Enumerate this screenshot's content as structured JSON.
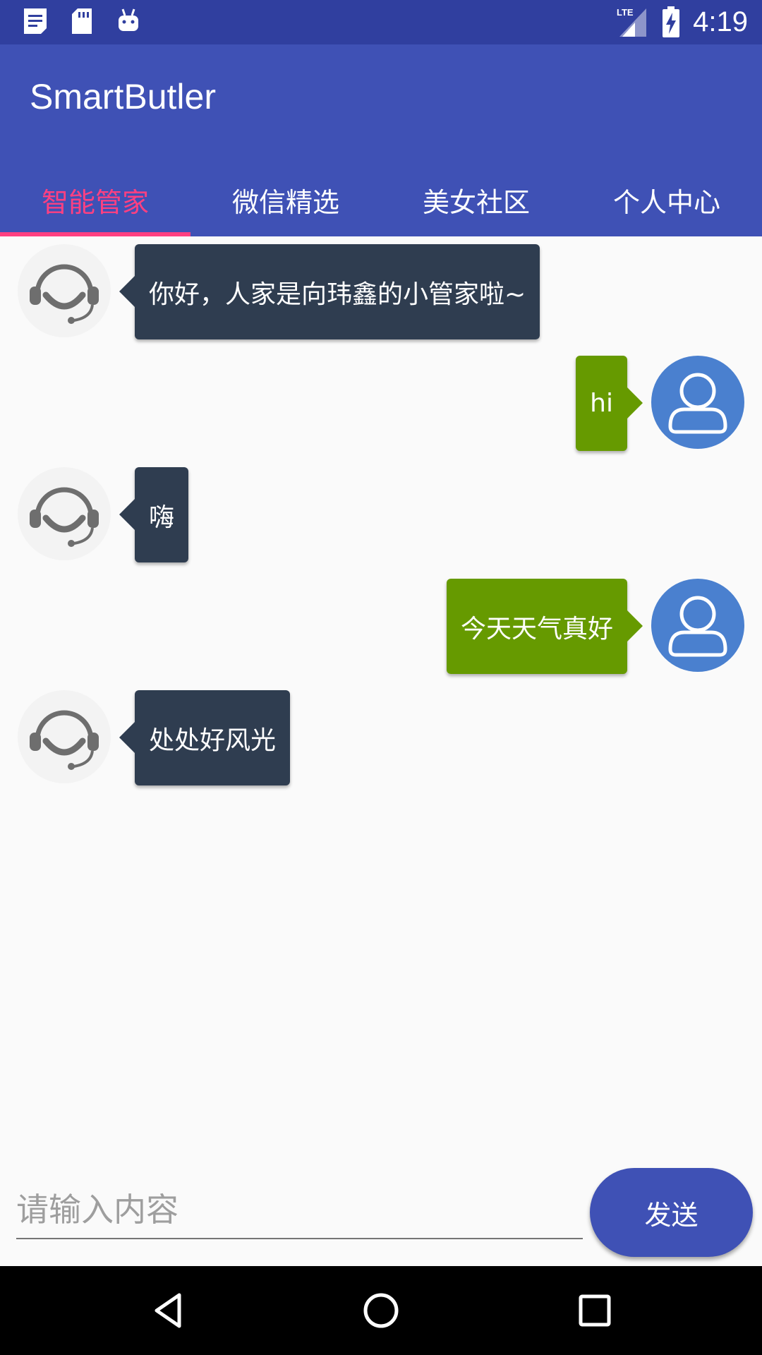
{
  "status_bar": {
    "time": "4:19",
    "network": "LTE",
    "left_icons": [
      "notes-icon",
      "sd-card-icon",
      "android-icon"
    ],
    "right_icons": [
      "lte-signal-icon",
      "battery-charging-icon"
    ]
  },
  "app": {
    "title": "SmartButler"
  },
  "tabs": [
    {
      "label": "智能管家",
      "active": true
    },
    {
      "label": "微信精选",
      "active": false
    },
    {
      "label": "美女社区",
      "active": false
    },
    {
      "label": "个人中心",
      "active": false
    }
  ],
  "messages": [
    {
      "sender": "bot",
      "text": "你好，人家是向玮鑫的小管家啦~"
    },
    {
      "sender": "user",
      "text": "hi"
    },
    {
      "sender": "bot",
      "text": "嗨"
    },
    {
      "sender": "user",
      "text": "今天天气真好"
    },
    {
      "sender": "bot",
      "text": "处处好风光"
    }
  ],
  "input": {
    "placeholder": "请输入内容",
    "value": ""
  },
  "send_button": {
    "label": "发送"
  },
  "nav_bar": {
    "icons": [
      "back-icon",
      "home-icon",
      "recents-icon"
    ]
  },
  "colors": {
    "status_bar": "#303f9f",
    "primary": "#3f51b5",
    "accent": "#ff4081",
    "bot_bubble": "#2f3d50",
    "user_bubble": "#669a00",
    "user_avatar": "#4a80cf",
    "background": "#fafafa"
  }
}
